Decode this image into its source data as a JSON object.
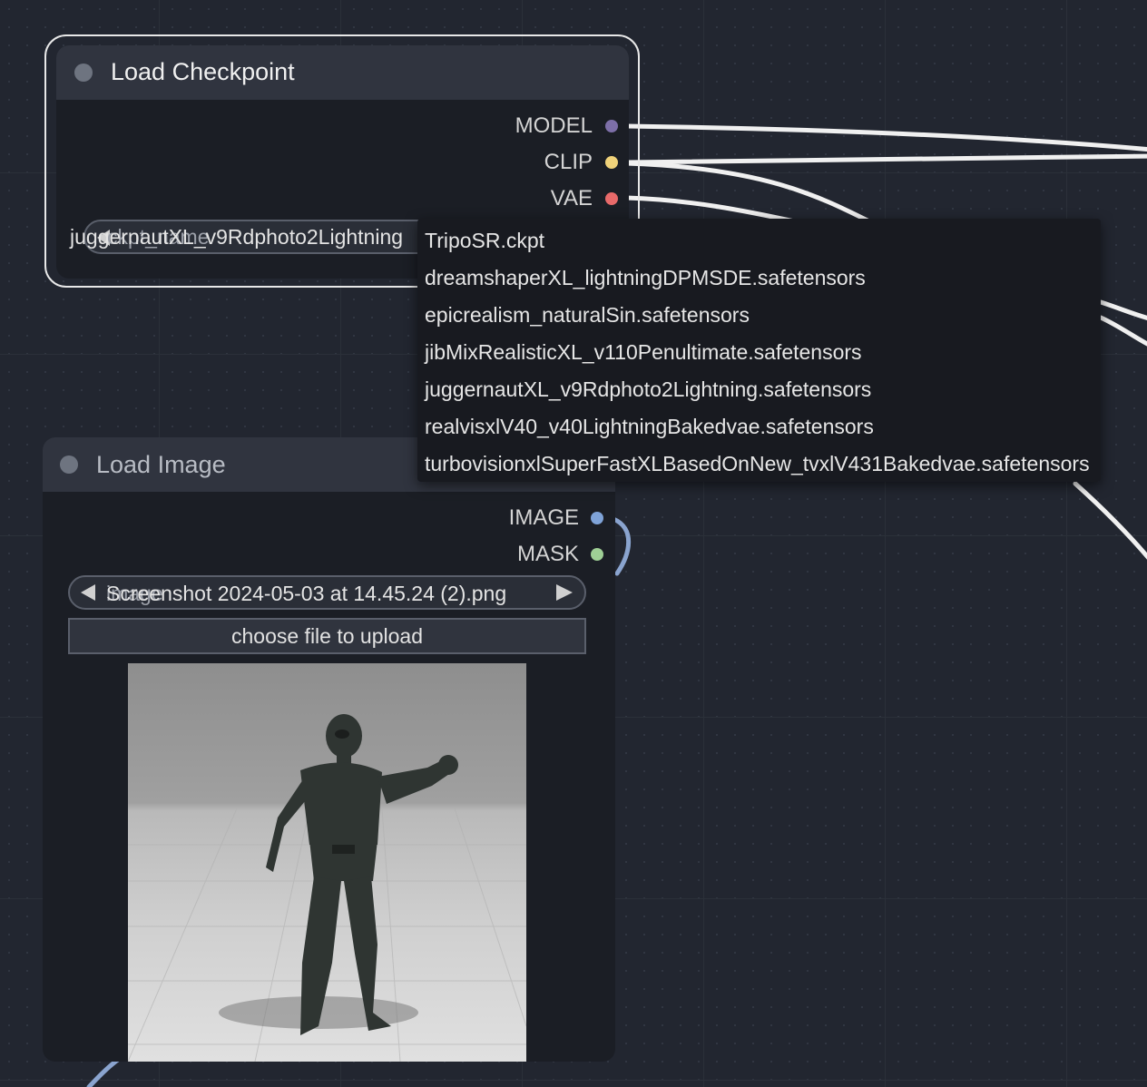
{
  "load_checkpoint": {
    "title": "Load Checkpoint",
    "outputs": [
      {
        "label": "MODEL",
        "color": "#7d6fa8"
      },
      {
        "label": "CLIP",
        "color": "#f0d27a"
      },
      {
        "label": "VAE",
        "color": "#e86a6a"
      }
    ],
    "widget": {
      "name": "ckpt_name",
      "value": "juggernautXL_v9Rdphoto2Lightning"
    }
  },
  "load_image": {
    "title": "Load Image",
    "outputs": [
      {
        "label": "IMAGE",
        "color": "#7fa3d8"
      },
      {
        "label": "MASK",
        "color": "#9fcf95"
      }
    ],
    "widget": {
      "name": "image",
      "value": "Screenshot 2024-05-03 at 14.45.24 (2).png"
    },
    "upload_label": "choose file to upload"
  },
  "dropdown": {
    "items": [
      "TripoSR.ckpt",
      "dreamshaperXL_lightningDPMSDE.safetensors",
      "epicrealism_naturalSin.safetensors",
      "jibMixRealisticXL_v110Penultimate.safetensors",
      "juggernautXL_v9Rdphoto2Lightning.safetensors",
      "realvisxlV40_v40LightningBakedvae.safetensors",
      "turbovisionxlSuperFastXLBasedOnNew_tvxlV431Bakedvae.safetensors"
    ]
  },
  "colors": {
    "canvas_bg": "#222630",
    "node_body": "#1b1e25",
    "node_title": "#30343f",
    "link": "#f2f2f2",
    "selected_outline": "#e8e8e8"
  }
}
